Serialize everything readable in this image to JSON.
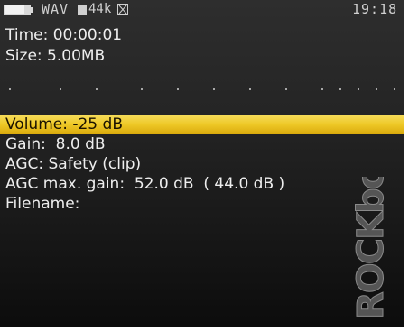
{
  "status_bar": {
    "battery_level": 0.8,
    "format": "WAV",
    "sample_rate": "44k",
    "clock": "19:18"
  },
  "recording": {
    "time": "Time: 00:00:01",
    "size": "Size: 5.00MB"
  },
  "peak_meter": {
    "level": 0
  },
  "menu": {
    "items": [
      {
        "label": "Volume: -25 dB",
        "selected": true
      },
      {
        "label": "Gain:  8.0 dB",
        "selected": false
      },
      {
        "label": "AGC: Safety (clip)",
        "selected": false
      },
      {
        "label": "AGC max. gain:  52.0 dB  ( 44.0 dB )",
        "selected": false
      },
      {
        "label": "Filename:",
        "selected": false
      }
    ]
  },
  "logo": {
    "text": "ROCKbox"
  },
  "colors": {
    "selection": "#eec826",
    "text": "#eeeeee",
    "background": "#1e1e1e"
  }
}
